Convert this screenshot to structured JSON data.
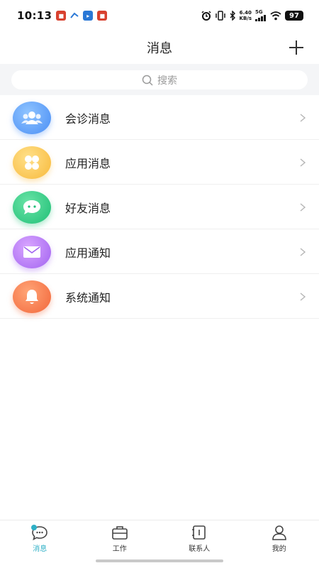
{
  "status_bar": {
    "time": "10:13",
    "net_speed_value": "6.40",
    "net_speed_unit": "KB/s",
    "network": "5G",
    "battery": "97"
  },
  "header": {
    "title": "消息",
    "add_icon": "plus-icon"
  },
  "search": {
    "placeholder": "搜索",
    "icon": "search-icon"
  },
  "messages": [
    {
      "label": "会诊消息",
      "icon": "group-icon",
      "color": "#4a8ef5"
    },
    {
      "label": "应用消息",
      "icon": "grid-icon",
      "color": "#f8b93a"
    },
    {
      "label": "好友消息",
      "icon": "chat-bubble-icon",
      "color": "#1fbf76"
    },
    {
      "label": "应用通知",
      "icon": "envelope-icon",
      "color": "#a162f0"
    },
    {
      "label": "系统通知",
      "icon": "bell-icon",
      "color": "#f2663a"
    }
  ],
  "tabs": [
    {
      "label": "消息",
      "icon": "message-icon",
      "active": true
    },
    {
      "label": "工作",
      "icon": "briefcase-icon",
      "active": false
    },
    {
      "label": "联系人",
      "icon": "contacts-book-icon",
      "active": false
    },
    {
      "label": "我的",
      "icon": "user-icon",
      "active": false
    }
  ],
  "colors": {
    "accent": "#2fb0c6",
    "divider": "#efefef",
    "search_bg": "#f4f5f7"
  }
}
